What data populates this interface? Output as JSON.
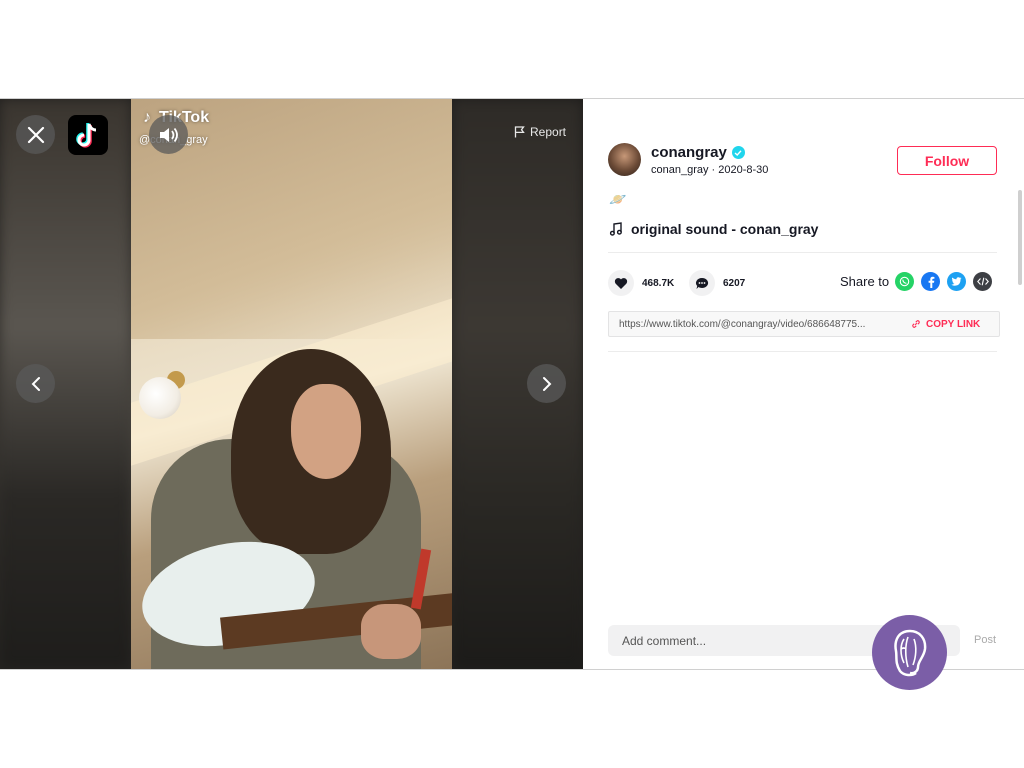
{
  "video": {
    "watermark_brand": "TikTok",
    "watermark_handle": "@conan_gray",
    "report_label": "Report"
  },
  "author": {
    "username": "conangray",
    "handle_date": "conan_gray · 2020-8-30",
    "follow_label": "Follow"
  },
  "post": {
    "caption_emoji": "🪐",
    "music_label": "original sound - conan_gray"
  },
  "stats": {
    "likes": "468.7K",
    "comments": "6207"
  },
  "share": {
    "label": "Share to",
    "icons": [
      "whatsapp-icon",
      "facebook-icon",
      "twitter-icon",
      "embed-icon"
    ],
    "link_url": "https://www.tiktok.com/@conangray/video/686648775...",
    "copy_label": "COPY LINK"
  },
  "comment": {
    "placeholder": "Add comment...",
    "post_label": "Post"
  },
  "colors": {
    "accent": "#fe2c55",
    "verified": "#20d5ec",
    "badge": "#7b5ea7"
  }
}
